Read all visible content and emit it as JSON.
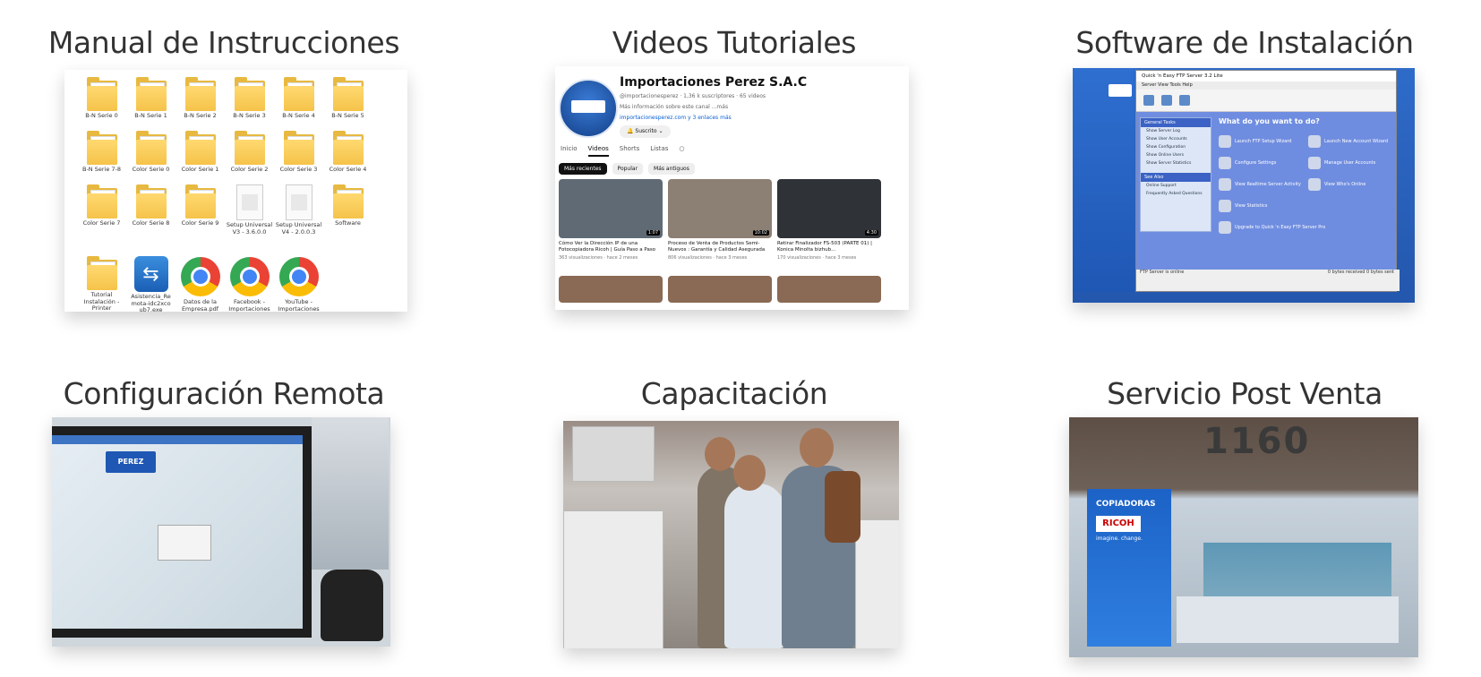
{
  "cards": [
    {
      "title": "Manual de Instrucciones"
    },
    {
      "title": "Videos Tutoriales"
    },
    {
      "title": "Software de Instalación"
    },
    {
      "title": "Configuración Remota"
    },
    {
      "title": "Capacitación"
    },
    {
      "title": "Servicio Post Venta"
    }
  ],
  "manual": {
    "items": [
      {
        "label": "B-N Serie 0",
        "icon": "folder-icon"
      },
      {
        "label": "B-N Serie 1",
        "icon": "folder-icon"
      },
      {
        "label": "B-N Serie 2",
        "icon": "folder-icon"
      },
      {
        "label": "B-N Serie 3",
        "icon": "folder-icon"
      },
      {
        "label": "B-N Serie 4",
        "icon": "folder-icon"
      },
      {
        "label": "B-N Serie 5",
        "icon": "folder-icon"
      },
      {
        "label": "B-N Serie 7-8",
        "icon": "folder-icon"
      },
      {
        "label": "Color Serie 0",
        "icon": "folder-icon"
      },
      {
        "label": "Color Serie 1",
        "icon": "folder-icon"
      },
      {
        "label": "Color Serie 2",
        "icon": "folder-icon"
      },
      {
        "label": "Color Serie 3",
        "icon": "folder-icon"
      },
      {
        "label": "Color Serie 4",
        "icon": "folder-icon"
      },
      {
        "label": "Color Serie 7",
        "icon": "folder-icon"
      },
      {
        "label": "Color Serie 8",
        "icon": "folder-icon"
      },
      {
        "label": "Color Serie 9",
        "icon": "folder-icon"
      },
      {
        "label": "Setup Universal V3 - 3.6.0.0",
        "icon": "document-icon"
      },
      {
        "label": "Setup Universal V4 - 2.0.0.3",
        "icon": "document-icon"
      },
      {
        "label": "Software",
        "icon": "folder-icon"
      },
      {
        "label": "Tutorial Instalación - Printer",
        "icon": "folder-icon"
      },
      {
        "label": "Asistencia_Re mota-idc2xco ub7.exe",
        "icon": "teamviewer-icon"
      },
      {
        "label": "Datos de la Empresa.pdf",
        "icon": "chrome-icon"
      },
      {
        "label": "Facebook - Importaciones Perez",
        "icon": "chrome-icon"
      },
      {
        "label": "YouTube - Importaciones Perez",
        "icon": "chrome-icon"
      }
    ]
  },
  "youtube": {
    "channel_name": "Importaciones Perez S.A.C",
    "meta": "@importacionesperez · 1,36 k suscriptores · 65 videos",
    "description": "Más información sobre este canal ...más",
    "links": "importacionesperez.com y 3 enlaces más",
    "subscribe": "Suscrito",
    "tabs": [
      "Inicio",
      "Videos",
      "Shorts",
      "Listas"
    ],
    "chips": [
      "Más recientes",
      "Popular",
      "Más antiguos"
    ],
    "videos": [
      {
        "title": "Cómo Ver la Dirección IP de una Fotocopiadora Ricoh | Guía Paso a Paso",
        "stats": "363 visualizaciones · hace 2 meses",
        "duration": "1:07",
        "color": "#5f6a74"
      },
      {
        "title": "Proceso de Venta de Productos Semi-Nuevos : Garantía y Calidad Asegurada",
        "stats": "806 visualizaciones · hace 3 meses",
        "duration": "10:02",
        "color": "#8c7f73"
      },
      {
        "title": "Retirar Finalizador FS-503 (PARTE 01) | Konica Minolta bizhub...",
        "stats": "170 visualizaciones · hace 3 meses",
        "duration": "4:30",
        "color": "#2f3338"
      }
    ]
  },
  "software": {
    "window_title": "Quick 'n Easy FTP Server 3.2 Lite",
    "menu": "Server  View  Tools  Help",
    "toolbar": [
      "Stop",
      "Home",
      "Setup"
    ],
    "side_title": "General Tasks",
    "side_items": [
      "Show Server Log",
      "Show User Accounts",
      "Show Configuration",
      "Show Online Users",
      "Show Server Statistics"
    ],
    "side_title2": "See Also",
    "side_items2": [
      "Online Support",
      "Frequently Asked Questions"
    ],
    "question": "What do you want to do?",
    "options": [
      "Launch FTP Setup Wizard",
      "Launch New Account Wizard",
      "Configure Settings",
      "Manage User Accounts",
      "View Realtime Server Activity",
      "View Who's Online",
      "View Statistics",
      "Upgrade to Quick 'n Easy FTP Server Pro"
    ],
    "status": "FTP Server is online",
    "status_right": "0 bytes received   0 bytes sent"
  },
  "remote": {
    "monitor_logo": "PEREZ"
  },
  "postventa": {
    "sign_number": "1160",
    "banner_line1": "COPIADORAS",
    "banner_line2": "RICOH",
    "banner_line3": "imagine. change."
  }
}
